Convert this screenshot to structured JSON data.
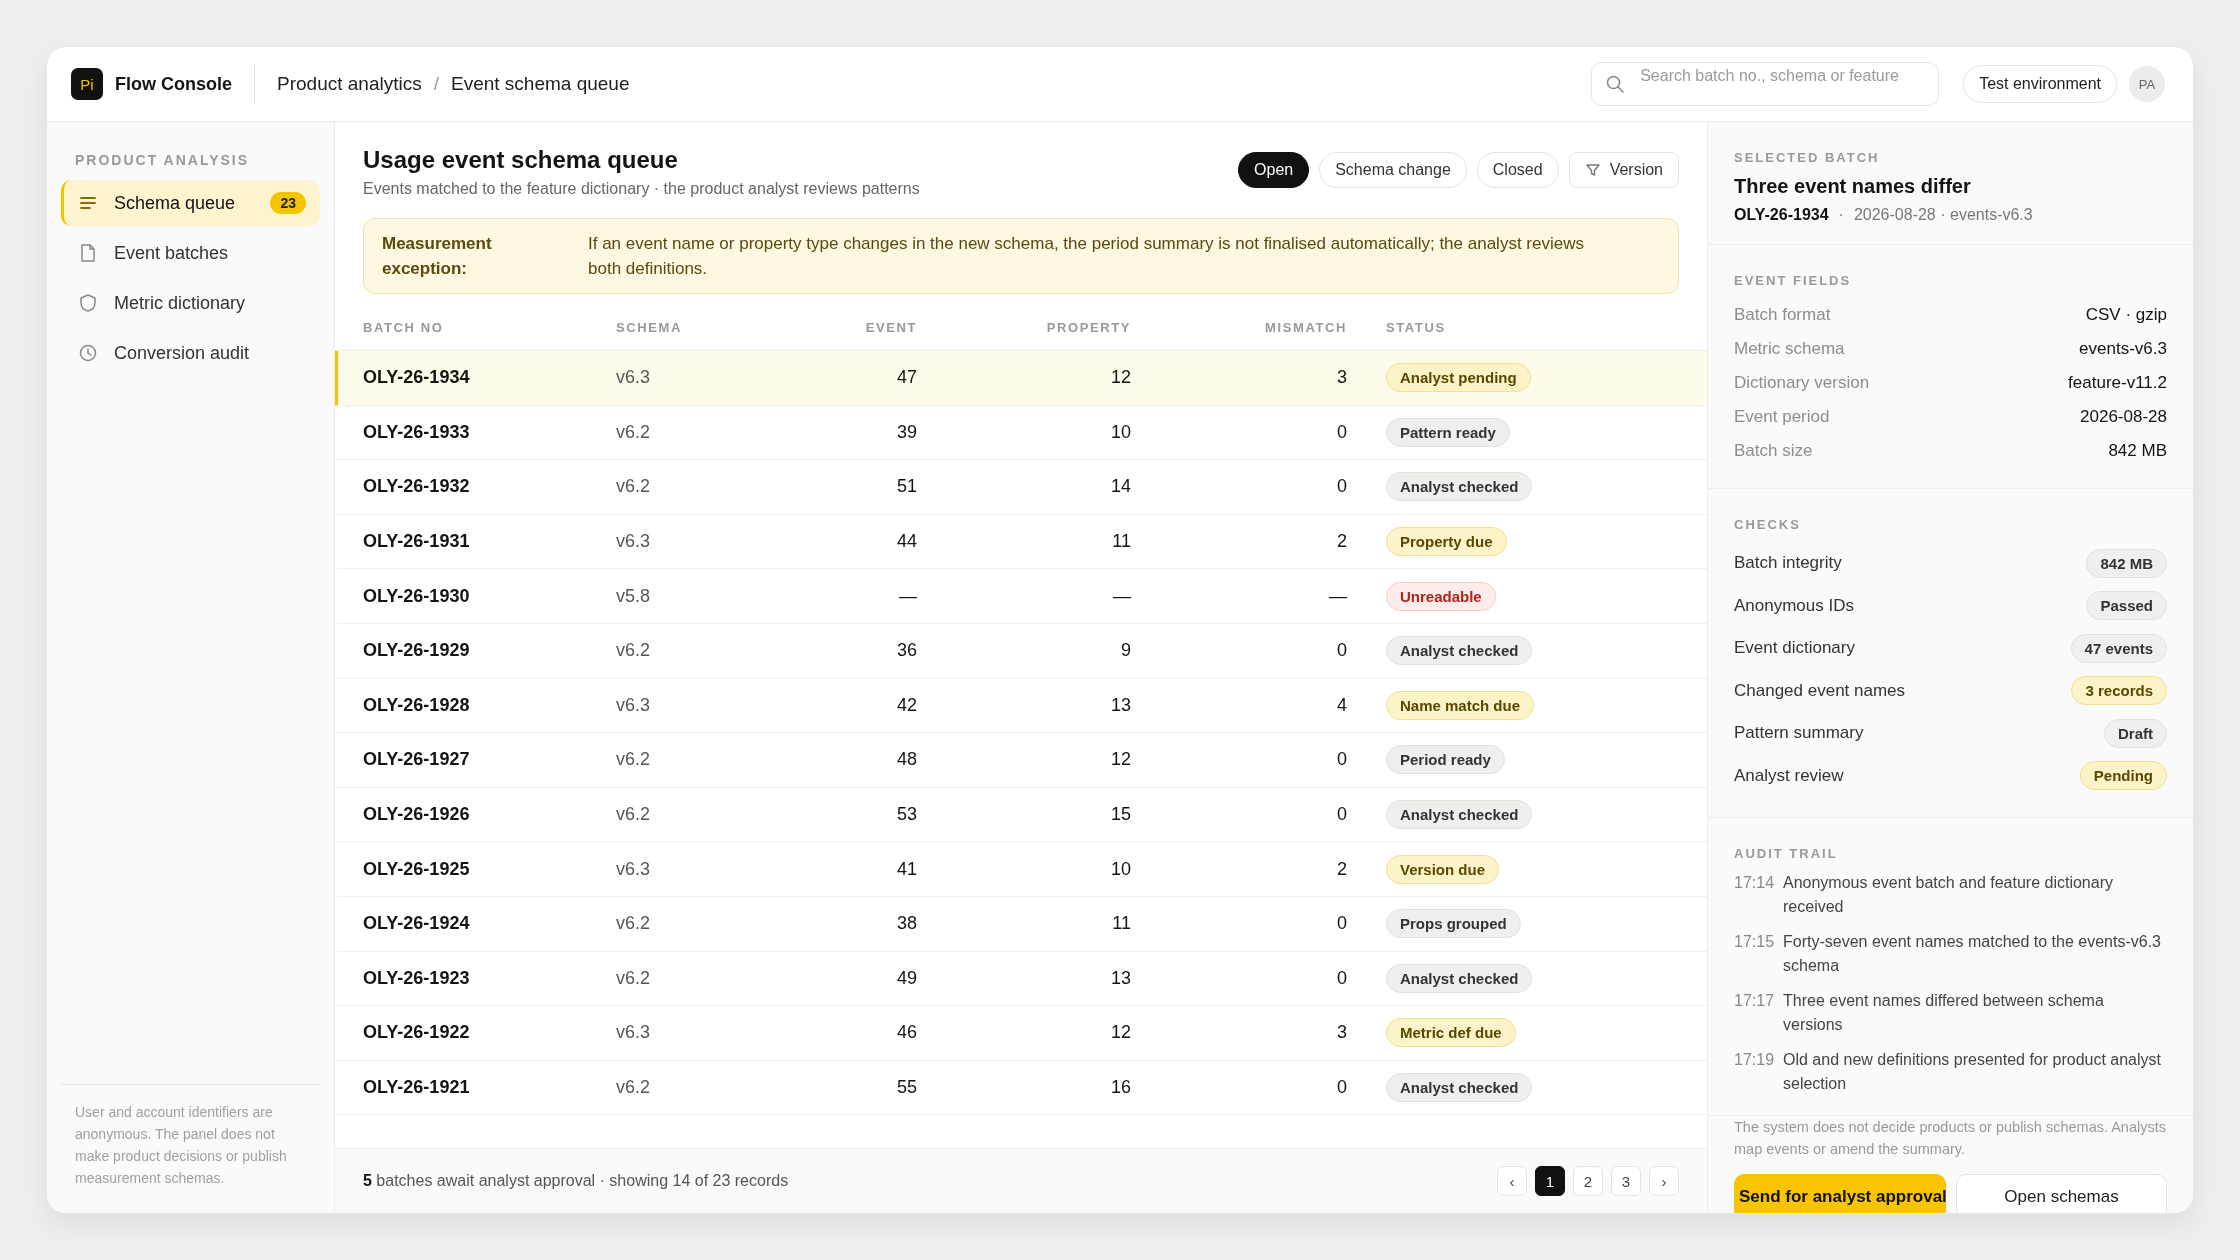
{
  "app": {
    "logo": "Pi",
    "name": "Flow Console"
  },
  "breadcrumb": {
    "items": [
      "Product analytics",
      "Event schema queue"
    ],
    "separator": "/"
  },
  "search": {
    "placeholder": "Search batch no., schema or feature"
  },
  "environment": "Test environment",
  "avatar": "PA",
  "sidebar": {
    "heading": "PRODUCT ANALYSIS",
    "items": [
      {
        "label": "Schema queue",
        "badge": "23",
        "selected": true
      },
      {
        "label": "Event batches",
        "selected": false
      },
      {
        "label": "Metric dictionary",
        "selected": false
      },
      {
        "label": "Conversion audit",
        "selected": false
      }
    ],
    "note": "User and account identifiers are anonymous. The panel does not make product decisions or publish measurement schemas."
  },
  "queue": {
    "title": "Usage event schema queue",
    "subtitle": "Events matched to the feature dictionary · the product analyst reviews patterns",
    "filters": [
      {
        "label": "Open",
        "kind": "chip",
        "selected": true
      },
      {
        "label": "Schema change",
        "kind": "chip",
        "selected": false
      },
      {
        "label": "Closed",
        "kind": "chip",
        "selected": false
      },
      {
        "label": "Version",
        "kind": "dropdown",
        "selected": false
      }
    ],
    "notice": {
      "label": "Measurement exception:",
      "text": "If an event name or property type changes in the new schema, the period summary is not finalised automatically; the analyst reviews both definitions."
    },
    "table": {
      "columns": [
        "BATCH NO",
        "SCHEMA",
        "EVENT",
        "PROPERTY",
        "MISMATCH",
        "STATUS"
      ],
      "rows": [
        {
          "batch_no": "OLY-26-1934",
          "schema": "v6.3",
          "event": "47",
          "property": "12",
          "mismatch": "3",
          "status": "Analyst pending",
          "kind": "warn",
          "selected": true
        },
        {
          "batch_no": "OLY-26-1933",
          "schema": "v6.2",
          "event": "39",
          "property": "10",
          "mismatch": "0",
          "status": "Pattern ready",
          "kind": "neutral",
          "selected": false
        },
        {
          "batch_no": "OLY-26-1932",
          "schema": "v6.2",
          "event": "51",
          "property": "14",
          "mismatch": "0",
          "status": "Analyst checked",
          "kind": "neutral",
          "selected": false
        },
        {
          "batch_no": "OLY-26-1931",
          "schema": "v6.3",
          "event": "44",
          "property": "11",
          "mismatch": "2",
          "status": "Property due",
          "kind": "warn",
          "selected": false
        },
        {
          "batch_no": "OLY-26-1930",
          "schema": "v5.8",
          "event": "—",
          "property": "—",
          "mismatch": "—",
          "status": "Unreadable",
          "kind": "danger",
          "selected": false
        },
        {
          "batch_no": "OLY-26-1929",
          "schema": "v6.2",
          "event": "36",
          "property": "9",
          "mismatch": "0",
          "status": "Analyst checked",
          "kind": "neutral",
          "selected": false
        },
        {
          "batch_no": "OLY-26-1928",
          "schema": "v6.3",
          "event": "42",
          "property": "13",
          "mismatch": "4",
          "status": "Name match due",
          "kind": "warn",
          "selected": false
        },
        {
          "batch_no": "OLY-26-1927",
          "schema": "v6.2",
          "event": "48",
          "property": "12",
          "mismatch": "0",
          "status": "Period ready",
          "kind": "neutral",
          "selected": false
        },
        {
          "batch_no": "OLY-26-1926",
          "schema": "v6.2",
          "event": "53",
          "property": "15",
          "mismatch": "0",
          "status": "Analyst checked",
          "kind": "neutral",
          "selected": false
        },
        {
          "batch_no": "OLY-26-1925",
          "schema": "v6.3",
          "event": "41",
          "property": "10",
          "mismatch": "2",
          "status": "Version due",
          "kind": "warn",
          "selected": false
        },
        {
          "batch_no": "OLY-26-1924",
          "schema": "v6.2",
          "event": "38",
          "property": "11",
          "mismatch": "0",
          "status": "Props grouped",
          "kind": "neutral",
          "selected": false
        },
        {
          "batch_no": "OLY-26-1923",
          "schema": "v6.2",
          "event": "49",
          "property": "13",
          "mismatch": "0",
          "status": "Analyst checked",
          "kind": "neutral",
          "selected": false
        },
        {
          "batch_no": "OLY-26-1922",
          "schema": "v6.3",
          "event": "46",
          "property": "12",
          "mismatch": "3",
          "status": "Metric def due",
          "kind": "warn",
          "selected": false
        },
        {
          "batch_no": "OLY-26-1921",
          "schema": "v6.2",
          "event": "55",
          "property": "16",
          "mismatch": "0",
          "status": "Analyst checked",
          "kind": "neutral",
          "selected": false
        }
      ]
    },
    "footer": {
      "summary": "**5** batches await analyst approval · showing 14 of 23 records",
      "prev": "‹",
      "next": "›",
      "pages": [
        {
          "label": "1",
          "selected": true
        },
        {
          "label": "2",
          "selected": false
        },
        {
          "label": "3",
          "selected": false
        }
      ]
    }
  },
  "detail": {
    "heading": "SELECTED BATCH",
    "title": "Three event names differ",
    "batch_no": "OLY-26-1934",
    "separator": "·",
    "meta": "2026-08-28 · events-v6.3",
    "fields": {
      "heading": "EVENT FIELDS",
      "items": [
        {
          "label": "Batch format",
          "value": "CSV · gzip"
        },
        {
          "label": "Metric schema",
          "value": "events-v6.3"
        },
        {
          "label": "Dictionary version",
          "value": "feature-v11.2"
        },
        {
          "label": "Event period",
          "value": "2026-08-28"
        },
        {
          "label": "Batch size",
          "value": "842 MB"
        }
      ]
    },
    "checks": {
      "heading": "CHECKS",
      "items": [
        {
          "label": "Batch integrity",
          "value": "842 MB",
          "kind": "neutral"
        },
        {
          "label": "Anonymous IDs",
          "value": "Passed",
          "kind": "neutral"
        },
        {
          "label": "Event dictionary",
          "value": "47 events",
          "kind": "neutral"
        },
        {
          "label": "Changed event names",
          "value": "3 records",
          "kind": "warn"
        },
        {
          "label": "Pattern summary",
          "value": "Draft",
          "kind": "neutral"
        },
        {
          "label": "Analyst review",
          "value": "Pending",
          "kind": "warn"
        }
      ]
    },
    "audit": {
      "heading": "AUDIT TRAIL",
      "entries": [
        {
          "time": "17:14",
          "text": "Anonymous event batch and feature dictionary received"
        },
        {
          "time": "17:15",
          "text": "Forty-seven event names matched to the events-v6.3 schema"
        },
        {
          "time": "17:17",
          "text": "Three event names differed between schema versions"
        },
        {
          "time": "17:19",
          "text": "Old and new definitions presented for product analyst selection"
        }
      ]
    },
    "disclaimer": "The system does not decide products or publish schemas. Analysts map events or amend the summary.",
    "actions": [
      {
        "label": "Send for analyst approval",
        "kind": "primary"
      },
      {
        "label": "Open schemas",
        "kind": "secondary"
      }
    ]
  }
}
